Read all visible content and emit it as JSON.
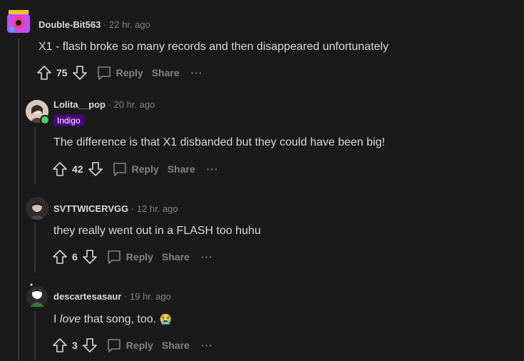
{
  "comments": [
    {
      "username": "Double-Bit563",
      "separator": "·",
      "time": "22 hr. ago",
      "body": "X1 - flash broke so many records and then disappeared unfortunately",
      "votes": "75",
      "reply_label": "Reply",
      "share_label": "Share",
      "more_label": "···"
    },
    {
      "username": "Lolita__pop",
      "separator": "·",
      "time": "20 hr. ago",
      "flair": "Indigo",
      "body": "The difference is that X1 disbanded but they could have been big!",
      "votes": "42",
      "reply_label": "Reply",
      "share_label": "Share",
      "more_label": "···"
    },
    {
      "username": "SVTTWICERVGG",
      "separator": "·",
      "time": "12 hr. ago",
      "body": "they really went out in a FLASH too huhu",
      "votes": "6",
      "reply_label": "Reply",
      "share_label": "Share",
      "more_label": "···"
    },
    {
      "username": "descartesasaur",
      "separator": "·",
      "time": "19 hr. ago",
      "body_prefix": "I ",
      "body_em": "love",
      "body_suffix": " that song, too.",
      "emoji": "😭",
      "votes": "3",
      "reply_label": "Reply",
      "share_label": "Share",
      "more_label": "···"
    }
  ],
  "colors": {
    "background": "#1a1a1b",
    "text": "#d7dadc",
    "meta": "#818384",
    "flair_bg": "#4b0082",
    "online": "#46d160"
  }
}
